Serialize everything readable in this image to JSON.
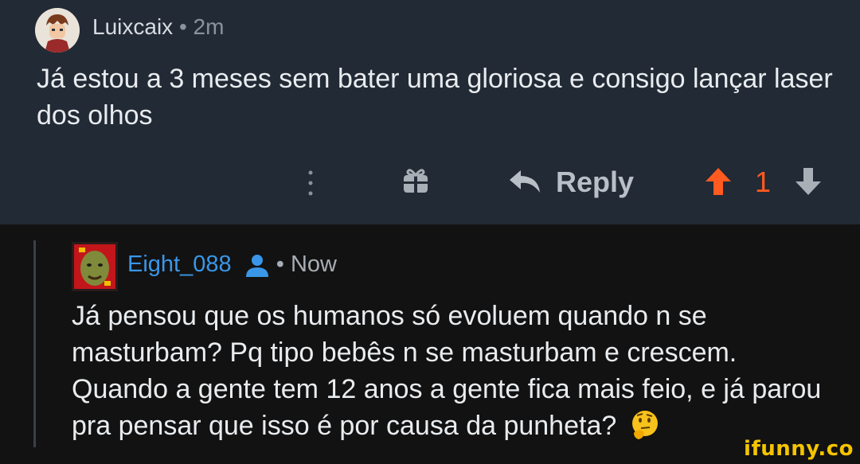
{
  "comment": {
    "username": "Luixcaix",
    "separator": "•",
    "time": "2m",
    "text": "Já estou a 3 meses sem bater uma gloriosa e consigo lançar laser dos olhos"
  },
  "actions": {
    "more_icon": "vertical-dots-icon",
    "gift_icon": "gift-icon",
    "reply_icon": "reply-arrow-icon",
    "reply_label": "Reply",
    "upvote_icon": "arrow-up-icon",
    "score": "1",
    "downvote_icon": "arrow-down-icon",
    "upvote_color": "#ff5a1f"
  },
  "reply": {
    "username": "Eight_088",
    "user_icon": "user-icon",
    "separator": "•",
    "time": "Now",
    "text": "Já pensou que os humanos só evoluem quando n se masturbam? Pq tipo bebês n se masturbam e crescem. Quando a gente tem 12 anos a gente fica mais feio, e já parou pra pensar que isso é por causa da punheta?",
    "emoji": "thinking-face-emoji",
    "username_color": "#3a96e8"
  },
  "watermark": "ifunny.co"
}
